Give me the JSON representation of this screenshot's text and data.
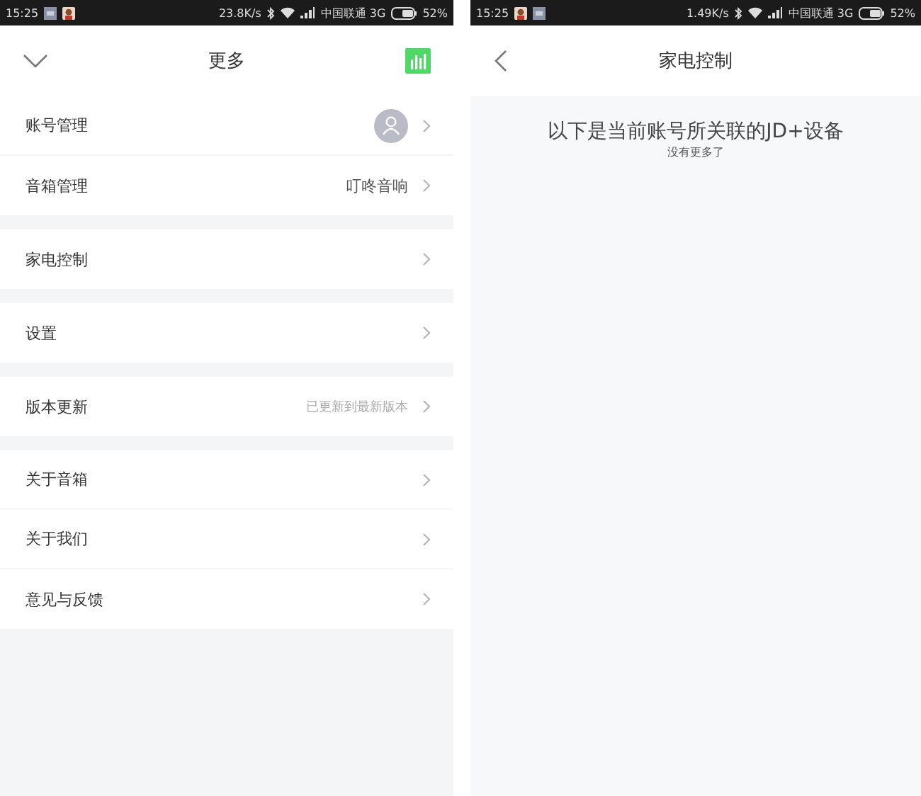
{
  "screens": [
    {
      "kind": "menu",
      "status_bar": {
        "time": "15:25",
        "notification_icons": [
          {
            "kind": "image"
          },
          {
            "kind": "app"
          }
        ],
        "net_speed": "23.8K/s",
        "carrier": "中国联通 3G",
        "battery": "52%"
      },
      "header": {
        "title": "更多"
      },
      "groups": [
        [
          {
            "label": "账号管理",
            "kind": "avatar"
          },
          {
            "label": "音箱管理",
            "kind": "value",
            "value": "叮咚音响"
          }
        ],
        [
          {
            "label": "家电控制",
            "kind": "plain"
          }
        ],
        [
          {
            "label": "设置",
            "kind": "plain"
          }
        ],
        [
          {
            "label": "版本更新",
            "kind": "hint",
            "value": "已更新到最新版本"
          }
        ],
        [
          {
            "label": "关于音箱",
            "kind": "plain"
          },
          {
            "label": "关于我们",
            "kind": "plain"
          },
          {
            "label": "意见与反馈",
            "kind": "plain"
          }
        ]
      ]
    },
    {
      "kind": "devices",
      "status_bar": {
        "time": "15:25",
        "notification_icons": [
          {
            "kind": "app"
          },
          {
            "kind": "image"
          }
        ],
        "net_speed": "1.49K/s",
        "carrier": "中国联通 3G",
        "battery": "52%"
      },
      "header": {
        "title": "家电控制"
      },
      "message": "以下是当前账号所关联的JD+设备",
      "note": "没有更多了"
    }
  ]
}
